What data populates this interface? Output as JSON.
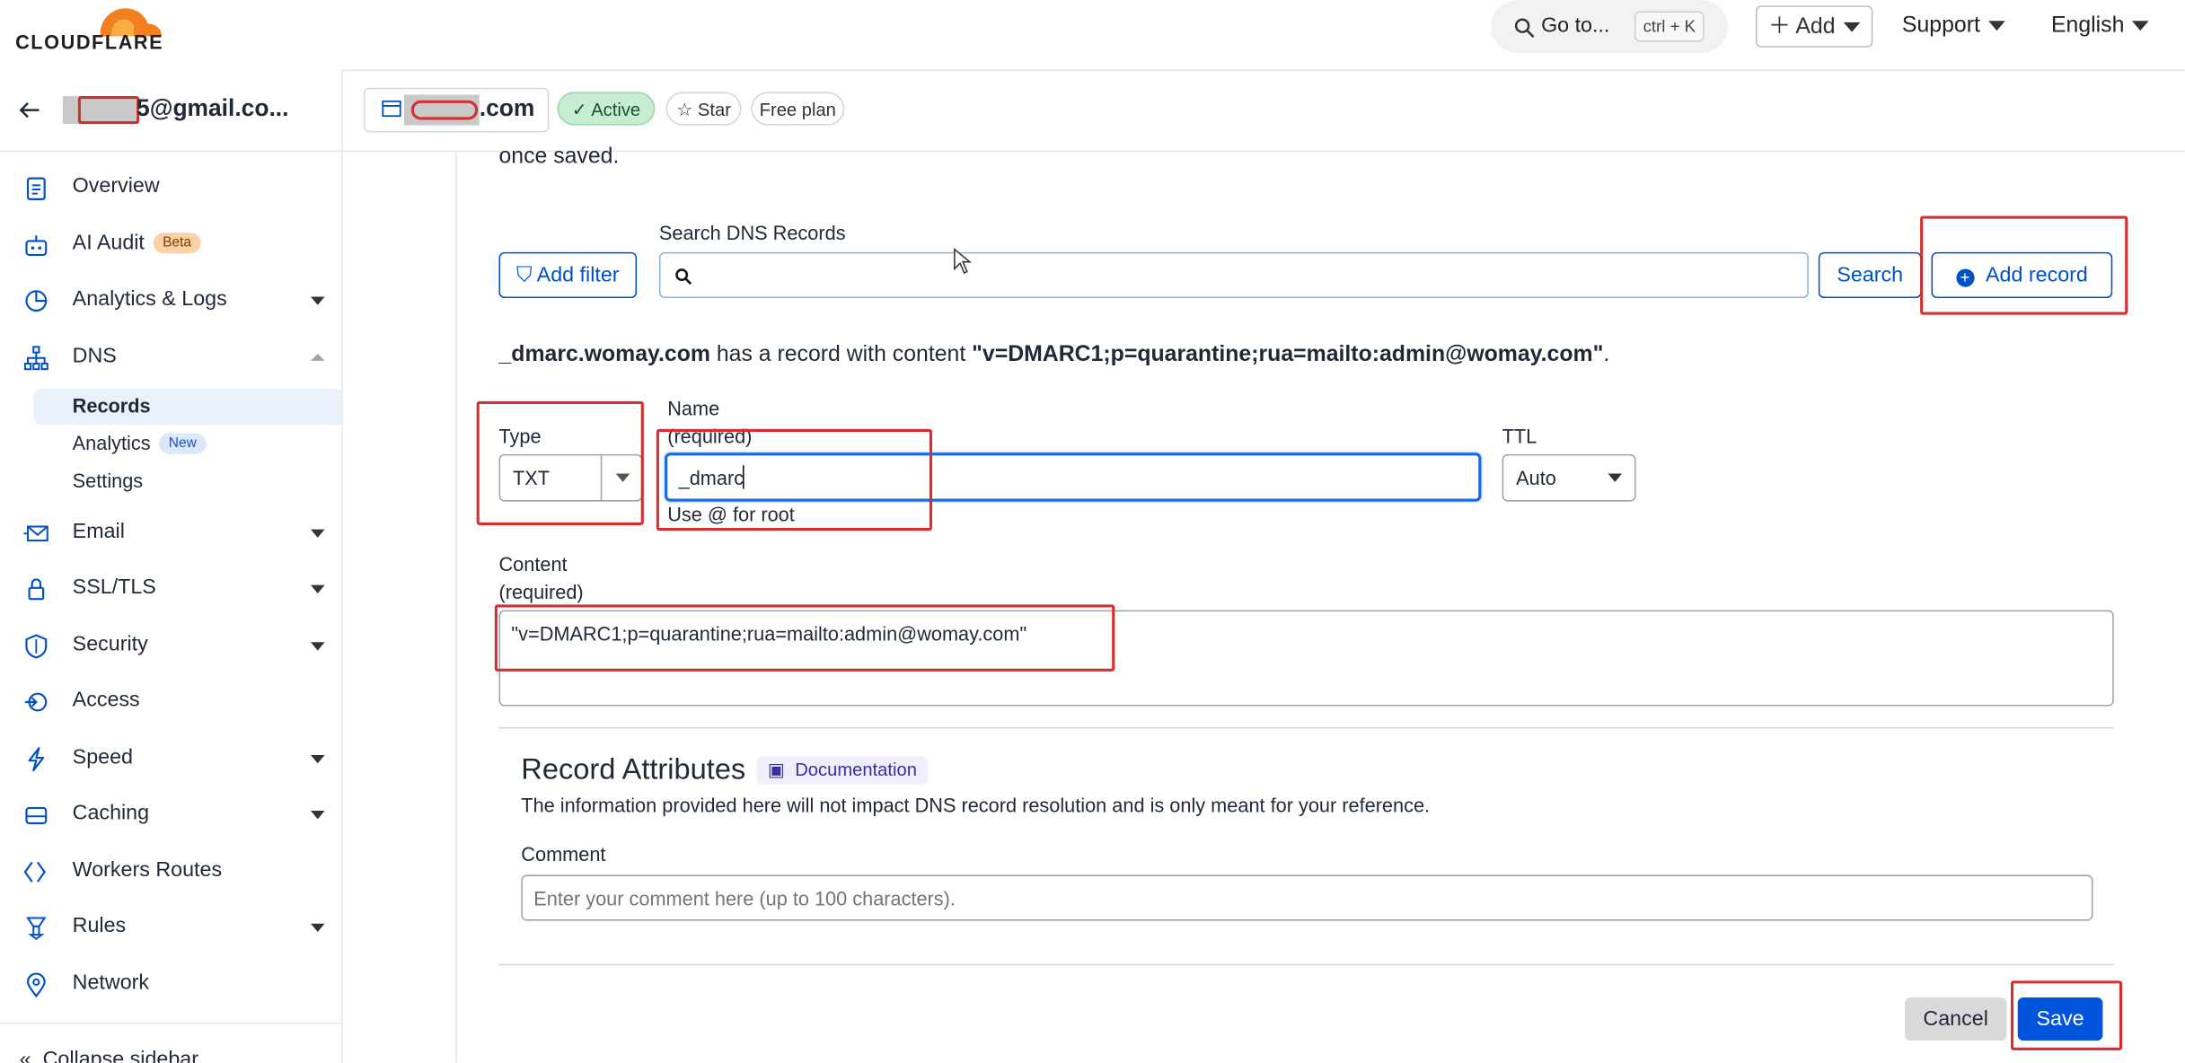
{
  "brand": {
    "name": "CLOUDFLARE",
    "logo_color": "#f38020"
  },
  "topbar": {
    "goto_label": "Go to...",
    "goto_shortcut": "ctrl + K",
    "add_label": "Add",
    "support_label": "Support",
    "language_label": "English"
  },
  "account": {
    "email_suffix": "5@gmail.co..."
  },
  "zone": {
    "domain_suffix": ".com",
    "status": "Active",
    "star_label": "Star",
    "plan": "Free plan"
  },
  "sidebar": {
    "items": [
      {
        "label": "Overview",
        "icon": "clipboard-icon"
      },
      {
        "label": "AI Audit",
        "icon": "robot-icon",
        "badge": "Beta"
      },
      {
        "label": "Analytics & Logs",
        "icon": "pie-chart-icon"
      },
      {
        "label": "DNS",
        "icon": "network-tree-icon"
      },
      {
        "label": "Email",
        "icon": "email-icon"
      },
      {
        "label": "SSL/TLS",
        "icon": "lock-icon"
      },
      {
        "label": "Security",
        "icon": "shield-icon"
      },
      {
        "label": "Access",
        "icon": "access-icon"
      },
      {
        "label": "Speed",
        "icon": "bolt-icon"
      },
      {
        "label": "Caching",
        "icon": "drive-icon"
      },
      {
        "label": "Workers Routes",
        "icon": "workers-icon"
      },
      {
        "label": "Rules",
        "icon": "rules-icon"
      },
      {
        "label": "Network",
        "icon": "location-pin-icon"
      }
    ],
    "dns_sub": [
      {
        "label": "Records"
      },
      {
        "label": "Analytics",
        "badge": "New"
      },
      {
        "label": "Settings"
      }
    ],
    "collapse_label": "Collapse sidebar"
  },
  "main": {
    "intro_tail": "once saved.",
    "search_label": "Search DNS Records",
    "add_filter_label": "Add filter",
    "search_button": "Search",
    "add_record_button": "Add record",
    "record_summary": {
      "name": "_dmarc.womay.com",
      "middle": " has a record with content ",
      "content": "\"v=DMARC1;p=quarantine;rua=mailto:admin@womay.com\"",
      "end": "."
    },
    "form": {
      "type_label": "Type",
      "type_value": "TXT",
      "name_label": "Name",
      "name_required": "(required)",
      "name_value": "_dmarc",
      "name_hint": "Use @ for root",
      "ttl_label": "TTL",
      "ttl_value": "Auto",
      "content_label": "Content",
      "content_required": "(required)",
      "content_value": "\"v=DMARC1;p=quarantine;rua=mailto:admin@womay.com\""
    },
    "attributes": {
      "title": "Record Attributes",
      "doc_label": "Documentation",
      "description": "The information provided here will not impact DNS record resolution and is only meant for your reference.",
      "comment_label": "Comment",
      "comment_placeholder": "Enter your comment here (up to 100 characters)."
    },
    "cancel_button": "Cancel",
    "save_button": "Save"
  },
  "colors": {
    "accent": "#0051c3",
    "save_bg": "#0055dc",
    "annotation": "#d32f2f",
    "active_green": "#c8ecd2"
  }
}
